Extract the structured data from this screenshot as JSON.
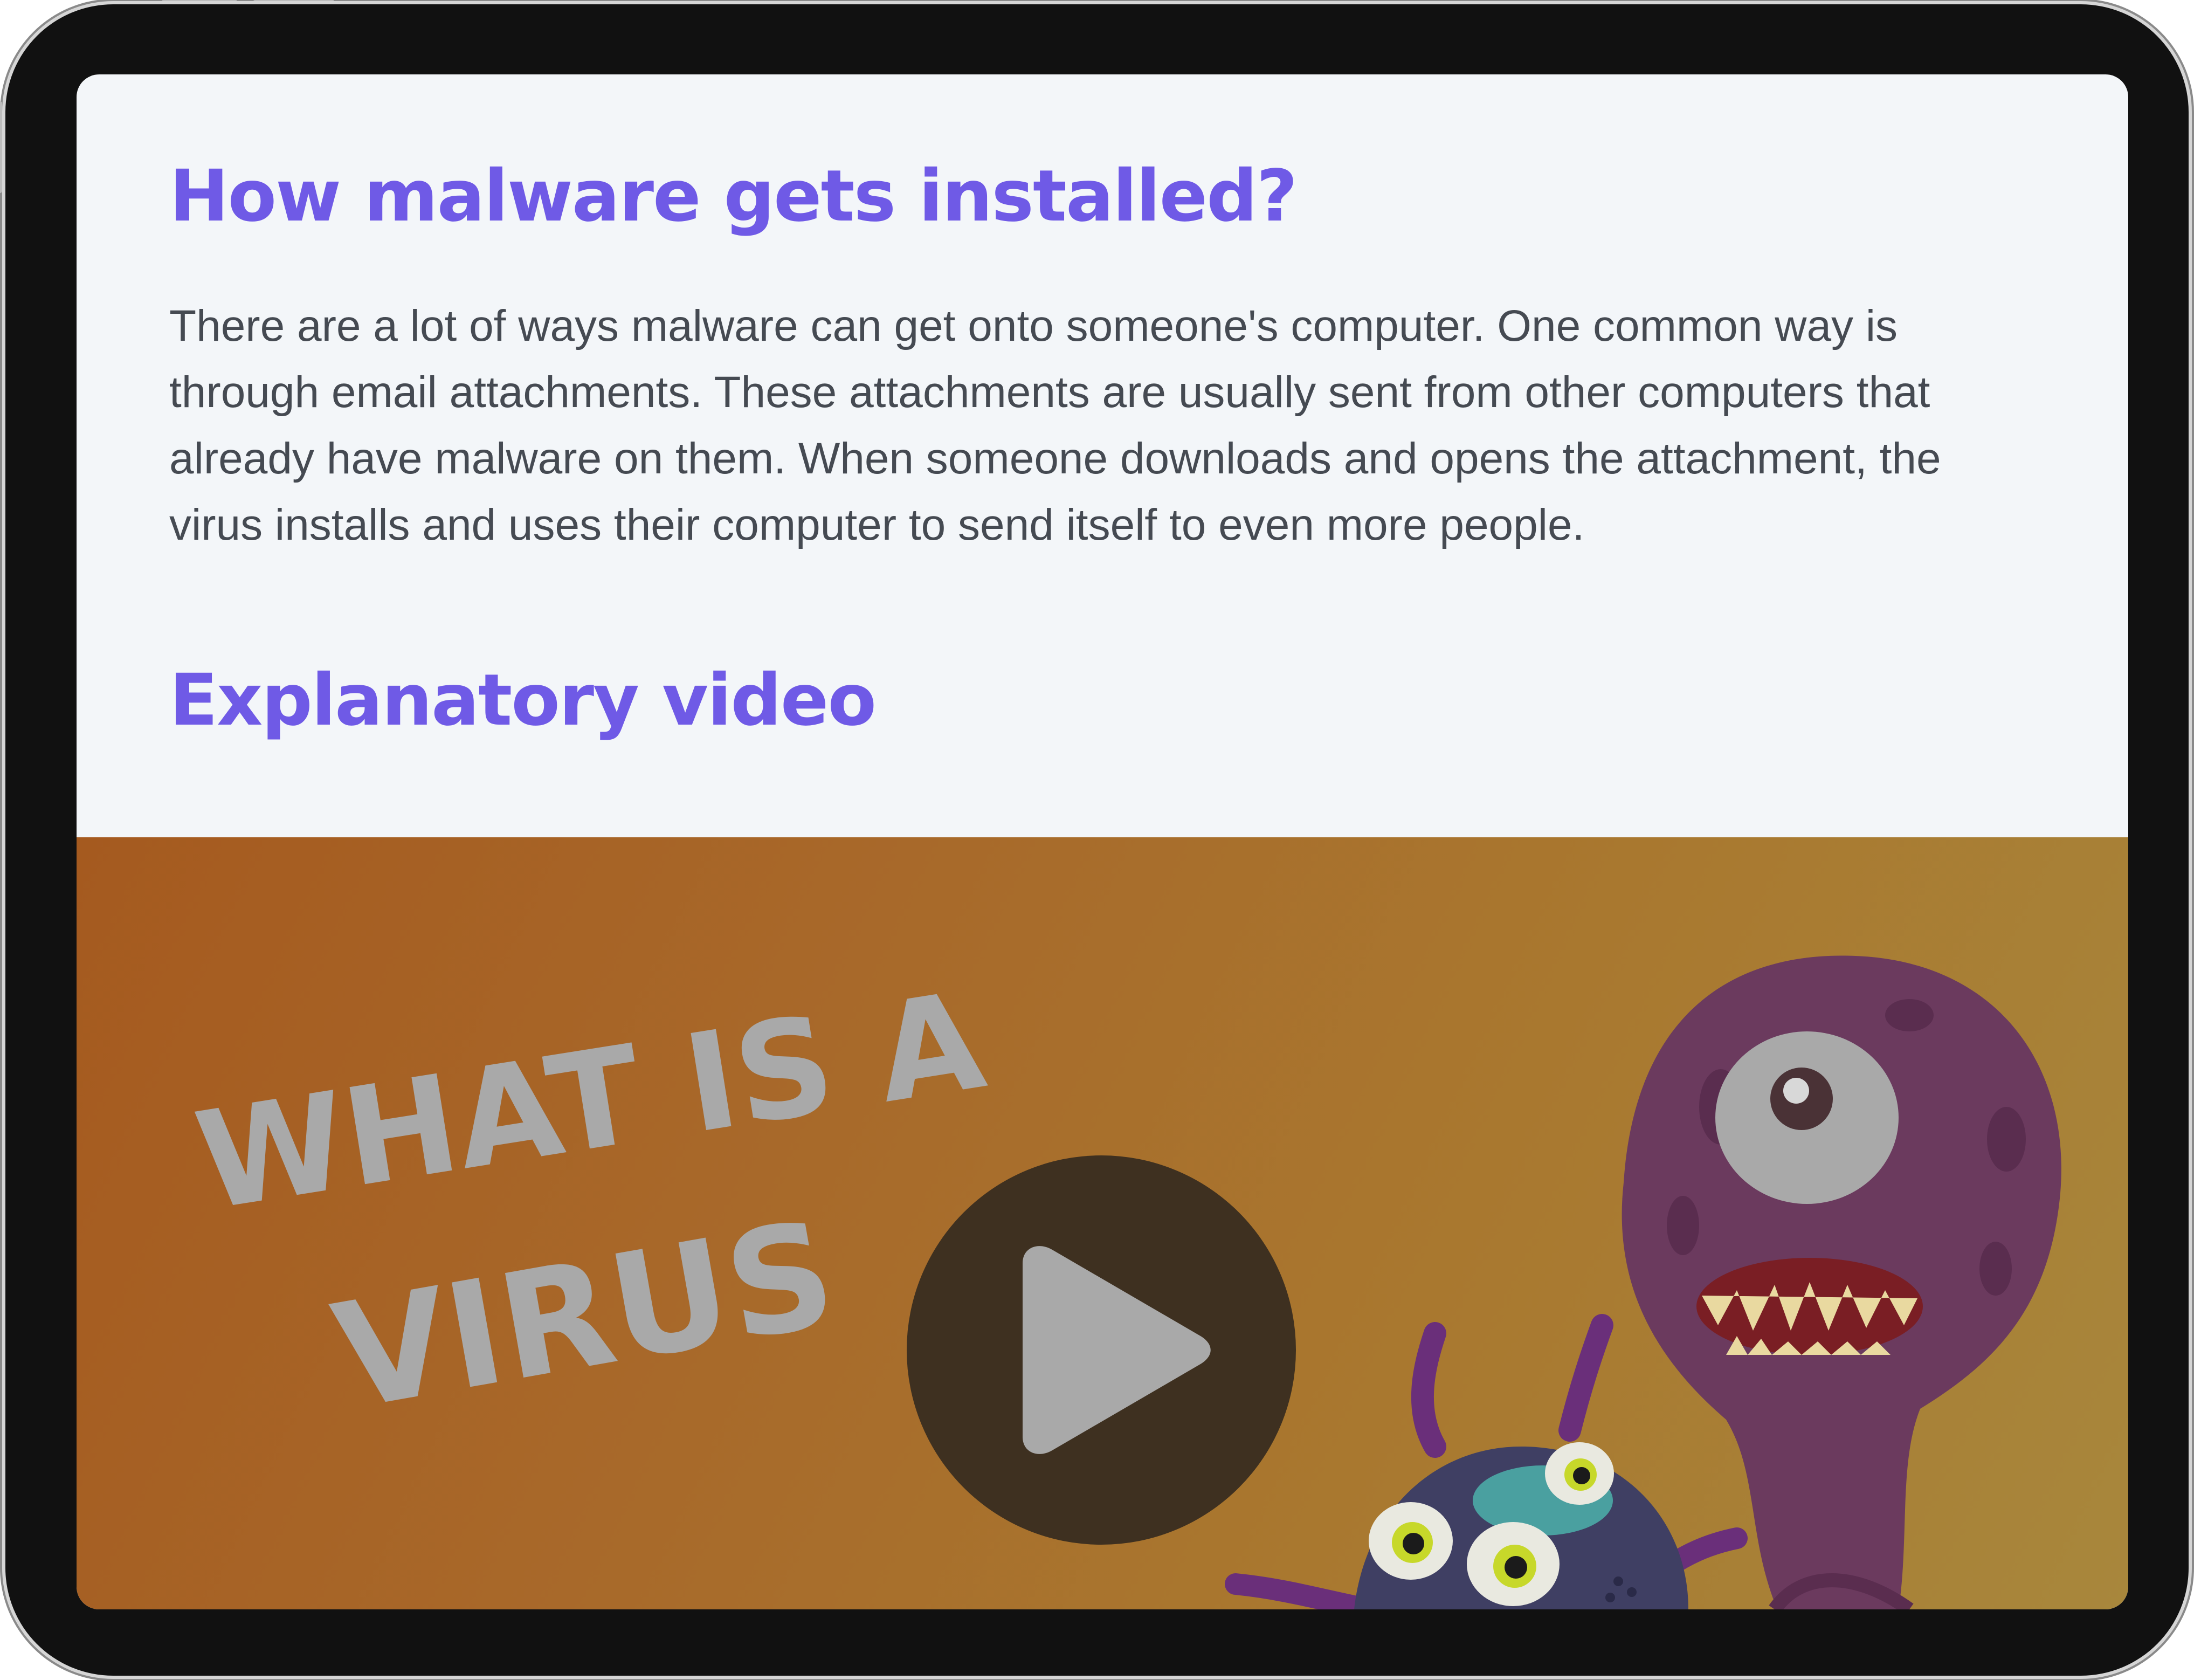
{
  "article": {
    "heading_malware": "How malware gets installed?",
    "paragraph": "There are a lot of ways malware can get onto someone's computer. One common way is through email attachments. These attachments are usually sent from other computers that already have malware on them. When someone downloads and opens the attachment, the virus installs and uses their computer to send itself to even more people.",
    "heading_video": "Explanatory video"
  },
  "video": {
    "thumbnail_line1": "WHAT IS A",
    "thumbnail_line2": "VIRUS",
    "play_icon": "play-icon",
    "colors": {
      "background_start": "#a55a1f",
      "background_end": "#a8873c",
      "title_text": "#a9a9a9",
      "play_button": "#3e3020"
    }
  },
  "theme": {
    "heading_color": "#6f5ae6",
    "body_text_color": "#454a52",
    "screen_background": "#f3f6f9",
    "device_frame": "#111111"
  }
}
